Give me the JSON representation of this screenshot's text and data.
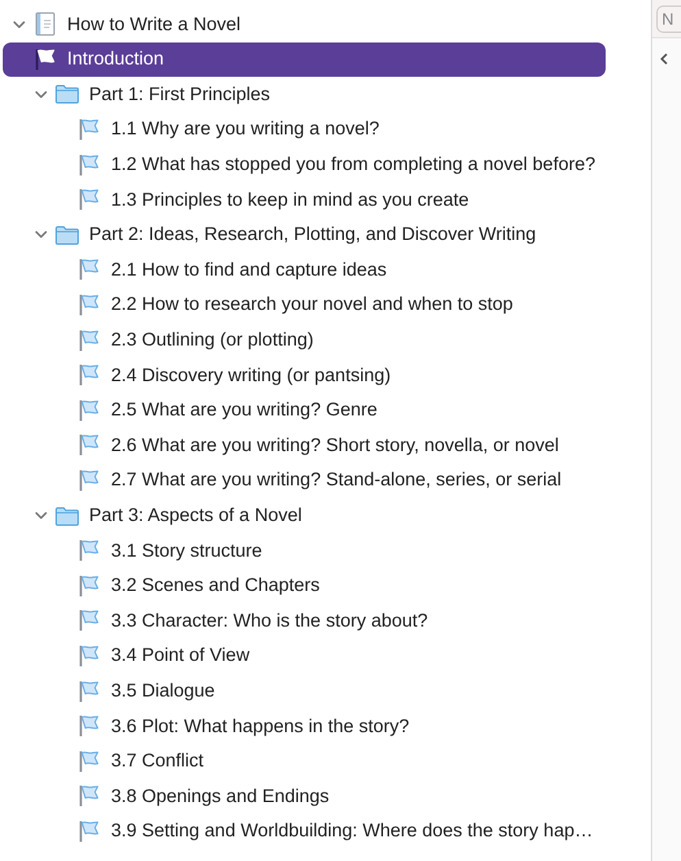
{
  "binder": [
    {
      "kind": "document",
      "label": "How to Write a Novel",
      "expanded": true,
      "selected": false,
      "children": [
        {
          "kind": "flag",
          "label": "Introduction",
          "selected": true
        },
        {
          "kind": "folder",
          "label": "Part 1: First Principles",
          "expanded": true,
          "selected": false,
          "children": [
            {
              "kind": "flag",
              "label": "1.1 Why are you writing a novel?",
              "selected": false
            },
            {
              "kind": "flag",
              "label": "1.2 What has stopped you from completing a novel before?",
              "selected": false
            },
            {
              "kind": "flag",
              "label": "1.3 Principles to keep in mind as you create",
              "selected": false
            }
          ]
        },
        {
          "kind": "folder",
          "label": "Part 2: Ideas, Research, Plotting, and Discover Writing",
          "expanded": true,
          "selected": false,
          "children": [
            {
              "kind": "flag",
              "label": "2.1 How to find and capture ideas",
              "selected": false
            },
            {
              "kind": "flag",
              "label": "2.2 How to research your novel and when to stop",
              "selected": false
            },
            {
              "kind": "flag",
              "label": "2.3 Outlining (or plotting)",
              "selected": false
            },
            {
              "kind": "flag",
              "label": "2.4 Discovery writing (or pantsing)",
              "selected": false
            },
            {
              "kind": "flag",
              "label": "2.5 What are you writing? Genre",
              "selected": false
            },
            {
              "kind": "flag",
              "label": "2.6 What are you writing? Short story, novella, or novel",
              "selected": false
            },
            {
              "kind": "flag",
              "label": "2.7 What are you writing? Stand-alone, series, or serial",
              "selected": false
            }
          ]
        },
        {
          "kind": "folder",
          "label": "Part 3: Aspects of a Novel",
          "expanded": true,
          "selected": false,
          "children": [
            {
              "kind": "flag",
              "label": "3.1 Story structure",
              "selected": false
            },
            {
              "kind": "flag",
              "label": "3.2 Scenes and Chapters",
              "selected": false
            },
            {
              "kind": "flag",
              "label": "3.3 Character: Who is the story about?",
              "selected": false
            },
            {
              "kind": "flag",
              "label": "3.4 Point of View",
              "selected": false
            },
            {
              "kind": "flag",
              "label": "3.5 Dialogue",
              "selected": false
            },
            {
              "kind": "flag",
              "label": "3.6 Plot: What happens in the story?",
              "selected": false
            },
            {
              "kind": "flag",
              "label": "3.7 Conflict",
              "selected": false
            },
            {
              "kind": "flag",
              "label": "3.8 Openings and Endings",
              "selected": false
            },
            {
              "kind": "flag",
              "label": "3.9 Setting and Worldbuilding: Where does the story hap…",
              "selected": false
            }
          ]
        }
      ]
    }
  ],
  "side_panel": {
    "field_text": "N"
  }
}
